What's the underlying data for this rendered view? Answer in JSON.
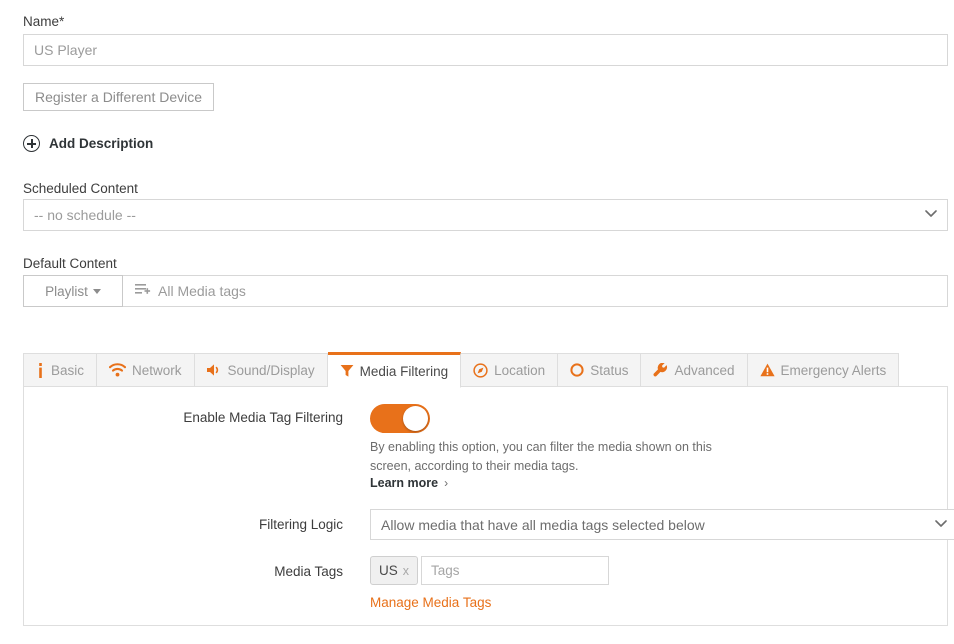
{
  "form": {
    "name_label": "Name*",
    "name_value": "US Player",
    "register_button": "Register a Different Device",
    "add_description": "Add Description",
    "scheduled_content_label": "Scheduled Content",
    "scheduled_content_value": "-- no schedule --",
    "default_content_label": "Default Content",
    "playlist_button": "Playlist",
    "default_media_tags": "All Media tags"
  },
  "tabs": [
    {
      "label": "Basic",
      "icon": "info-icon",
      "active": false
    },
    {
      "label": "Network",
      "icon": "wifi-icon",
      "active": false
    },
    {
      "label": "Sound/Display",
      "icon": "speaker-icon",
      "active": false
    },
    {
      "label": "Media Filtering",
      "icon": "filter-icon",
      "active": true
    },
    {
      "label": "Location",
      "icon": "compass-icon",
      "active": false
    },
    {
      "label": "Status",
      "icon": "circle-icon",
      "active": false
    },
    {
      "label": "Advanced",
      "icon": "wrench-icon",
      "active": false
    },
    {
      "label": "Emergency Alerts",
      "icon": "warning-triangle-icon",
      "active": false
    }
  ],
  "media_filtering": {
    "enable_label": "Enable Media Tag Filtering",
    "enable_state": "on",
    "help_text": "By enabling this option, you can filter the media shown on this screen, according to their media tags.",
    "learn_more": "Learn more",
    "filtering_logic_label": "Filtering Logic",
    "filtering_logic_value": "Allow media that have all media tags selected below",
    "media_tags_label": "Media Tags",
    "tags": [
      {
        "label": "US",
        "remove": "x"
      }
    ],
    "tags_placeholder": "Tags",
    "manage_media_tags": "Manage Media Tags"
  },
  "colors": {
    "accent": "#e8711a",
    "border": "#dedede",
    "text": "#4a4a4a",
    "muted": "#9b9b9b"
  }
}
